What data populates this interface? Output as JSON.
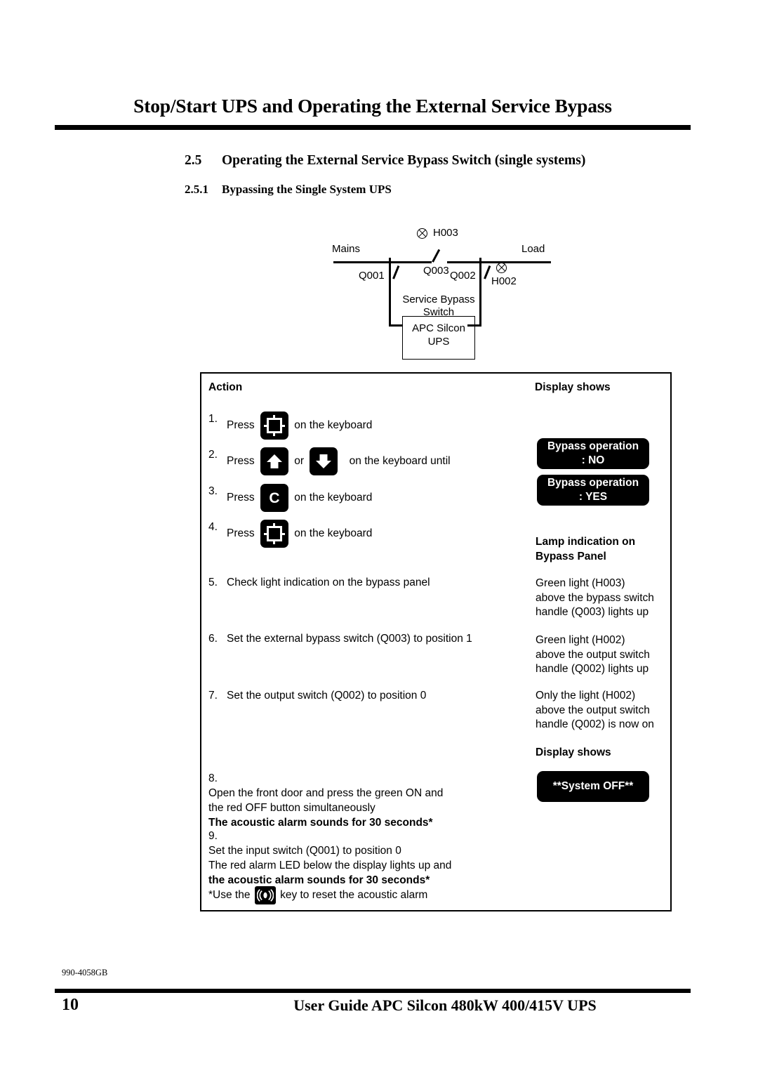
{
  "header": {
    "title": "Stop/Start UPS and Operating the External Service Bypass",
    "section_number": "2.5",
    "section_title": "Operating the External Service Bypass Switch (single systems)",
    "subsection_number": "2.5.1",
    "subsection_title": "Bypassing the Single System UPS"
  },
  "diagram": {
    "mains": "Mains",
    "load": "Load",
    "h003": "H003",
    "h002": "H002",
    "q001": "Q001",
    "q002": "Q002",
    "q003": "Q003",
    "service_bypass": "Service Bypass",
    "switch": "Switch",
    "ups_line1": "APC Silcon",
    "ups_line2": "UPS"
  },
  "table": {
    "col_action": "Action",
    "col_display": "Display shows",
    "steps": [
      {
        "num": "1.",
        "pre": "Press",
        "key": "frame-key",
        "post": "on the keyboard"
      },
      {
        "num": "2.",
        "pre": "Press",
        "key": "up-arrow-key",
        "mid": "or",
        "key2": "down-arrow-key",
        "post": "on the keyboard until"
      },
      {
        "num": "3.",
        "pre": "Press",
        "key": "c-key",
        "post": "on the keyboard"
      },
      {
        "num": "4.",
        "pre": "Press",
        "key": "frame-key",
        "post": "on the keyboard"
      },
      {
        "num": "5.",
        "text": "Check light indication on the bypass panel"
      },
      {
        "num": "6.",
        "text": "Set the external bypass switch (Q003) to position 1"
      },
      {
        "num": "7.",
        "text": "Set the output switch (Q002) to position 0"
      },
      {
        "num": "8.",
        "line1": "Open the front door and press the green ON and",
        "line2": "the red OFF button simultaneously",
        "line3_bold": "The acoustic alarm sounds for 30 seconds*"
      },
      {
        "num": "9.",
        "line1": "Set the input switch (Q001) to position 0",
        "line2": "The red alarm LED below the display lights up and",
        "line3_bold": "the acoustic alarm sounds for 30 seconds*"
      }
    ],
    "footnote_pre": "*Use the",
    "footnote_key": "alarm-key",
    "footnote_post": "key  to reset the acoustic alarm",
    "display_boxes": {
      "bypass_no_l1": "Bypass operation",
      "bypass_no_l2": ": NO",
      "bypass_yes_l1": "Bypass operation",
      "bypass_yes_l2": ": YES",
      "system_off": "**System OFF**"
    },
    "right_column": {
      "lamp_heading": "Lamp indication on\nBypass Panel",
      "step5_result": "Green light (H003)\nabove the bypass switch\nhandle (Q003) lights up",
      "step6_result": "Green light (H002)\nabove the output switch\nhandle (Q002) lights up",
      "step7_result": "Only the light (H002)\nabove the output switch\nhandle (Q002) is now on",
      "display_shows_2": "Display shows"
    }
  },
  "footer": {
    "doc_code": "990-4058GB",
    "page_number": "10",
    "guide_title": "User Guide APC Silcon 480kW 400/415V UPS"
  },
  "colors": {
    "ink": "#000000",
    "paper": "#ffffff",
    "lcd_bg": "#000000",
    "lcd_fg": "#ffffff"
  }
}
